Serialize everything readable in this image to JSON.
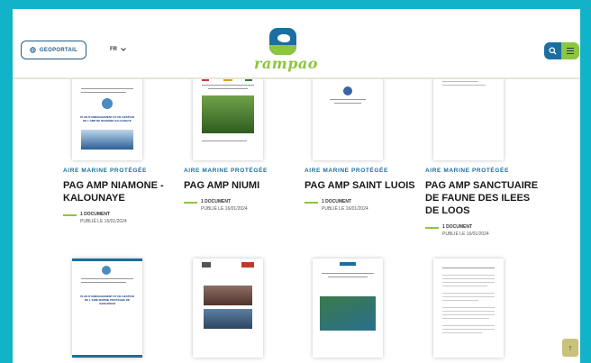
{
  "header": {
    "geoportail_label": "GEOPORTAIL",
    "lang_label": "FR",
    "logo_text": "rampao"
  },
  "cards": [
    {
      "category": "AIRE MARINE PROTÉGÉE",
      "title": "PAG AMP NIAMONE - KALOUNAYE",
      "doc_count": "1 DOCUMENT",
      "published": "PUBLIÉ LE 16/01/2024",
      "cover_text": "PLAN D'AMENAGEMENT ET DE GESTION DE L'AMP DE NIAMONE KALOUNAYE"
    },
    {
      "category": "AIRE MARINE PROTÉGÉE",
      "title": "PAG AMP NIUMI",
      "doc_count": "1 DOCUMENT",
      "published": "PUBLIÉ LE 16/01/2024",
      "cover_text": ""
    },
    {
      "category": "AIRE MARINE PROTÉGÉE",
      "title": "PAG AMP SAINT LUOIS",
      "doc_count": "1 DOCUMENT",
      "published": "PUBLIÉ LE 16/01/2024",
      "cover_text": ""
    },
    {
      "category": "AIRE MARINE PROTÉGÉE",
      "title": "PAG AMP SANCTUAIRE DE FAUNE DES ILEES DE LOOS",
      "doc_count": "1 DOCUMENT",
      "published": "PUBLIÉ LE 16/01/2024",
      "cover_text": ""
    }
  ],
  "bottom_covers": [
    {
      "cover_text": "PLAN D'AMENAGEMENT ET DE GESTION DE L'AIRE MARINE PROTEGEE DE SANGOMAR"
    },
    {
      "cover_text": ""
    },
    {
      "cover_text": ""
    },
    {
      "cover_text": ""
    }
  ],
  "colors": {
    "accent_blue": "#1a6fa0",
    "accent_green": "#8cc63f",
    "frame": "#12b3c9"
  },
  "icons": {
    "geoportail": "globe-icon",
    "search": "search-icon",
    "menu": "hamburger-icon",
    "scroll_top": "arrow-up-icon"
  }
}
